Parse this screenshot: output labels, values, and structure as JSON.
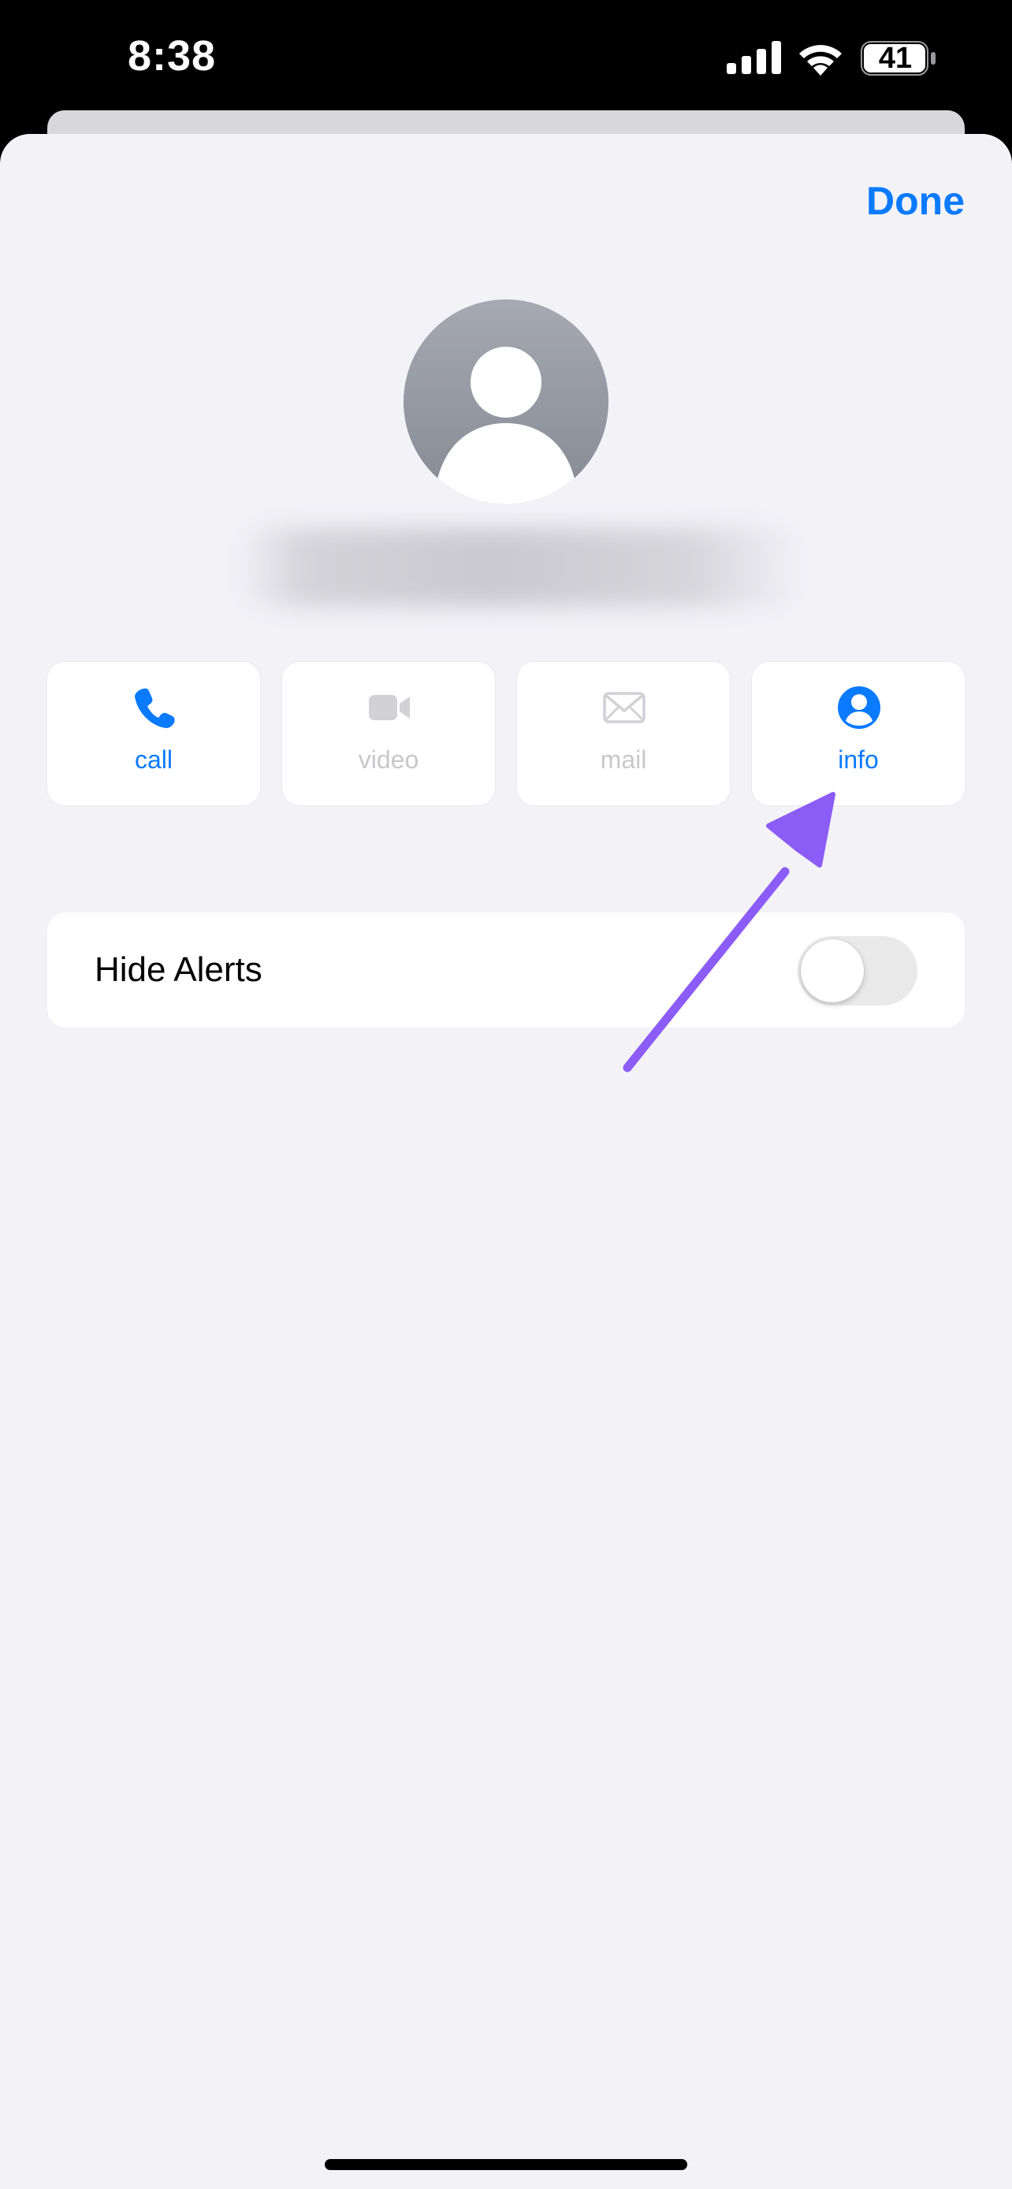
{
  "status_bar": {
    "time": "8:38",
    "battery_level": "41",
    "icons": [
      "signal-icon",
      "wifi-icon",
      "battery-icon"
    ]
  },
  "header": {
    "done_label": "Done"
  },
  "contact": {
    "name": ""
  },
  "actions": [
    {
      "label": "call",
      "icon": "phone-icon",
      "enabled": true
    },
    {
      "label": "video",
      "icon": "video-camera-icon",
      "enabled": false
    },
    {
      "label": "mail",
      "icon": "envelope-icon",
      "enabled": false
    },
    {
      "label": "info",
      "icon": "person-circle-icon",
      "enabled": true
    }
  ],
  "settings": {
    "hide_alerts_label": "Hide Alerts",
    "hide_alerts_on": false
  },
  "colors": {
    "accent": "#0a7aff",
    "disabled": "#c8c8cc",
    "background": "#f2f2f7",
    "annotation": "#8b5cf6"
  }
}
